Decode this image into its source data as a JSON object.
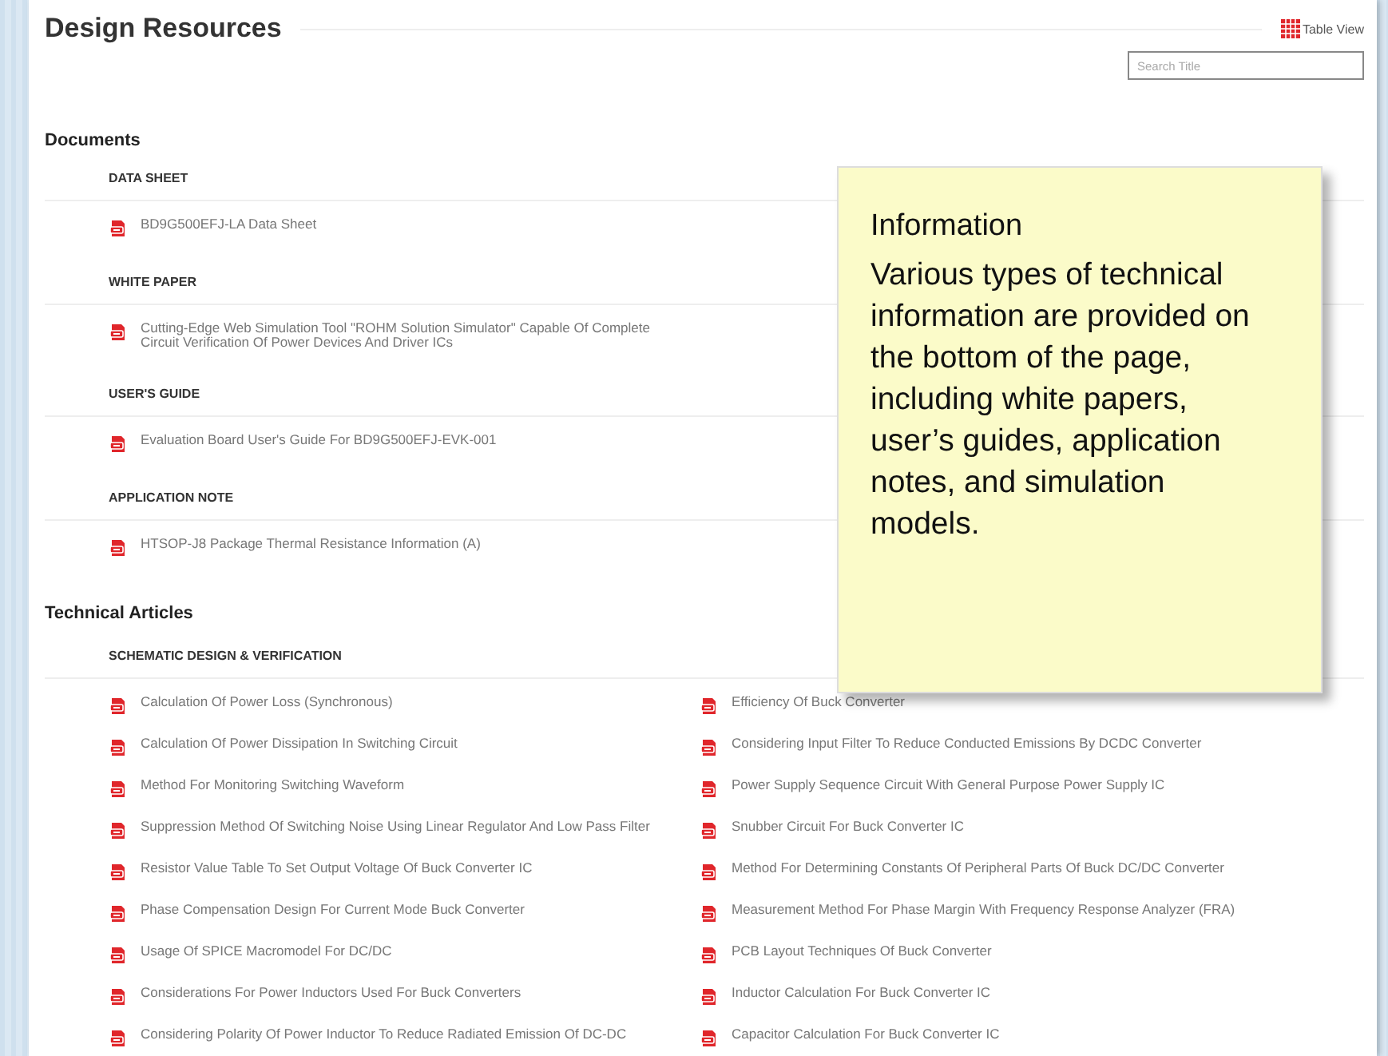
{
  "title": "Design Resources",
  "view_toggle": "Table View",
  "search": {
    "placeholder": "Search Title"
  },
  "sections": [
    {
      "heading": "Documents",
      "groups": [
        {
          "heading": "DATA SHEET",
          "kind": "list",
          "items": [
            "BD9G500EFJ-LA Data Sheet"
          ]
        },
        {
          "heading": "WHITE PAPER",
          "kind": "list",
          "items": [
            "Cutting-Edge Web Simulation Tool \"ROHM Solution Simulator\" Capable Of Complete Circuit Verification Of Power Devices And Driver ICs"
          ]
        },
        {
          "heading": "USER'S GUIDE",
          "kind": "list",
          "items": [
            "Evaluation Board User's Guide For BD9G500EFJ-EVK-001"
          ]
        },
        {
          "heading": "APPLICATION NOTE",
          "kind": "list",
          "items": [
            "HTSOP-J8 Package Thermal Resistance Information (A)"
          ]
        }
      ]
    },
    {
      "heading": "Technical Articles",
      "groups": [
        {
          "heading": "SCHEMATIC DESIGN & VERIFICATION",
          "kind": "grid",
          "items": [
            "Calculation Of Power Loss (Synchronous)",
            "Efficiency Of Buck Converter",
            "Calculation Of Power Dissipation In Switching Circuit",
            "Considering Input Filter To Reduce Conducted Emissions By DCDC Converter",
            "Method For Monitoring Switching Waveform",
            "Power Supply Sequence Circuit With General Purpose Power Supply IC",
            "Suppression Method Of Switching Noise Using Linear Regulator And Low Pass Filter",
            "Snubber Circuit For Buck Converter IC",
            "Resistor Value Table To Set Output Voltage Of Buck Converter IC",
            "Method For Determining Constants Of Peripheral Parts Of Buck DC/DC Converter",
            "Phase Compensation Design For Current Mode Buck Converter",
            "Measurement Method For Phase Margin With Frequency Response Analyzer (FRA)",
            "Usage Of SPICE Macromodel For DC/DC",
            "PCB Layout Techniques Of Buck Converter",
            "Considerations For Power Inductors Used For Buck Converters",
            "Inductor Calculation For Buck Converter IC",
            "Considering Polarity Of Power Inductor To Reduce Radiated Emission Of DC-DC",
            "Capacitor Calculation For Buck Converter IC"
          ]
        }
      ]
    }
  ],
  "note": {
    "title": "Information",
    "body": "Various types of technical information are provided on the bottom of the page, including white papers, user’s guides, application notes, and simulation models."
  }
}
